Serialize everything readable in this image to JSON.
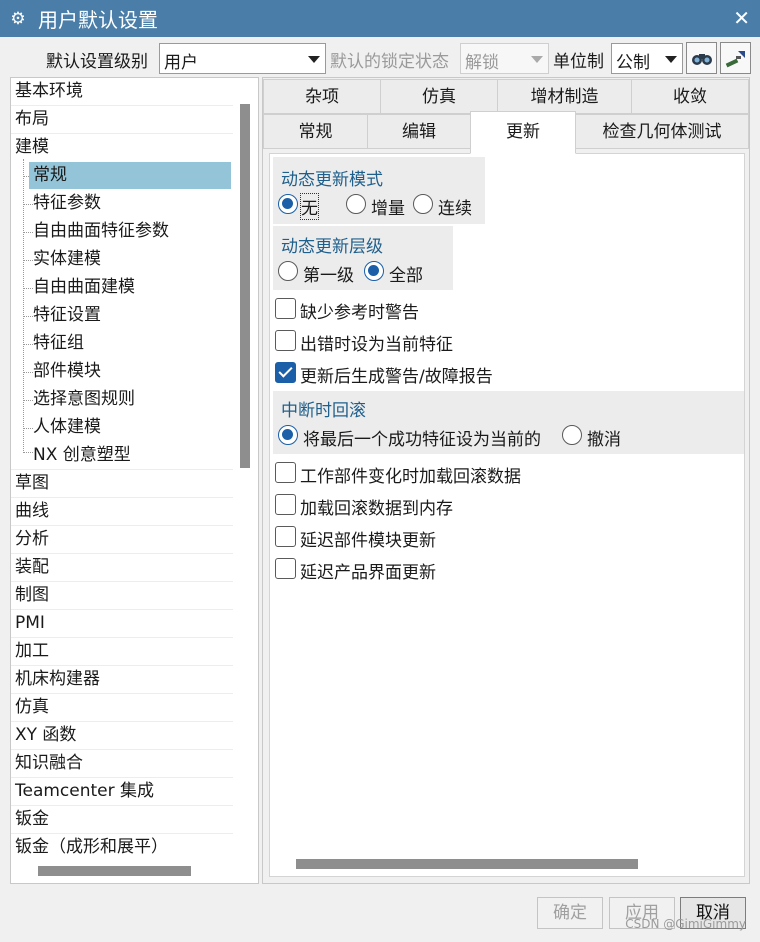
{
  "window": {
    "title": "用户默认设置",
    "close_glyph": "✕",
    "title_icon": "gear-icon"
  },
  "toolbar": {
    "level_label": "默认设置级别",
    "level_value": "用户",
    "lock_label": "默认的锁定状态",
    "lock_value": "解锁",
    "unit_label": "单位制",
    "unit_value": "公制"
  },
  "tree": {
    "items": [
      {
        "label": "基本环境"
      },
      {
        "label": "布局"
      },
      {
        "label": "建模"
      },
      {
        "label": "常规"
      },
      {
        "label": "特征参数"
      },
      {
        "label": "自由曲面特征参数"
      },
      {
        "label": "实体建模"
      },
      {
        "label": "自由曲面建模"
      },
      {
        "label": "特征设置"
      },
      {
        "label": "特征组"
      },
      {
        "label": "部件模块"
      },
      {
        "label": "选择意图规则"
      },
      {
        "label": "人体建模"
      },
      {
        "label": "NX 创意塑型"
      },
      {
        "label": "草图"
      },
      {
        "label": "曲线"
      },
      {
        "label": "分析"
      },
      {
        "label": "装配"
      },
      {
        "label": "制图"
      },
      {
        "label": "PMI"
      },
      {
        "label": "加工"
      },
      {
        "label": "机床构建器"
      },
      {
        "label": "仿真"
      },
      {
        "label": "XY 函数"
      },
      {
        "label": "知识融合"
      },
      {
        "label": "Teamcenter 集成"
      },
      {
        "label": "钣金"
      },
      {
        "label": "钣金（成形和展平）"
      }
    ]
  },
  "tabs": {
    "row1": [
      {
        "label": "杂项"
      },
      {
        "label": "仿真"
      },
      {
        "label": "增材制造"
      },
      {
        "label": "收敛"
      }
    ],
    "row2": [
      {
        "label": "常规"
      },
      {
        "label": "编辑"
      },
      {
        "label": "更新"
      },
      {
        "label": "检查几何体测试"
      }
    ],
    "active": "更新"
  },
  "update": {
    "dynamic_mode": {
      "title": "动态更新模式",
      "options": [
        "无",
        "增量",
        "连续"
      ],
      "selected": "无"
    },
    "dynamic_level": {
      "title": "动态更新层级",
      "options": [
        "第一级",
        "全部"
      ],
      "selected": "全部"
    },
    "checks_a": [
      {
        "label": "缺少参考时警告",
        "checked": false
      },
      {
        "label": "出错时设为当前特征",
        "checked": false
      },
      {
        "label": "更新后生成警告/故障报告",
        "checked": true
      }
    ],
    "rollback": {
      "title": "中断时回滚",
      "options": [
        "将最后一个成功特征设为当前的",
        "撤消"
      ],
      "selected": "将最后一个成功特征设为当前的"
    },
    "checks_b": [
      {
        "label": "工作部件变化时加载回滚数据",
        "checked": false
      },
      {
        "label": "加载回滚数据到内存",
        "checked": false
      },
      {
        "label": "延迟部件模块更新",
        "checked": false
      },
      {
        "label": "延迟产品界面更新",
        "checked": false
      }
    ]
  },
  "footer": {
    "ok": "确定",
    "apply": "应用",
    "cancel": "取消"
  },
  "watermark": "CSDN @GimiGimmy"
}
